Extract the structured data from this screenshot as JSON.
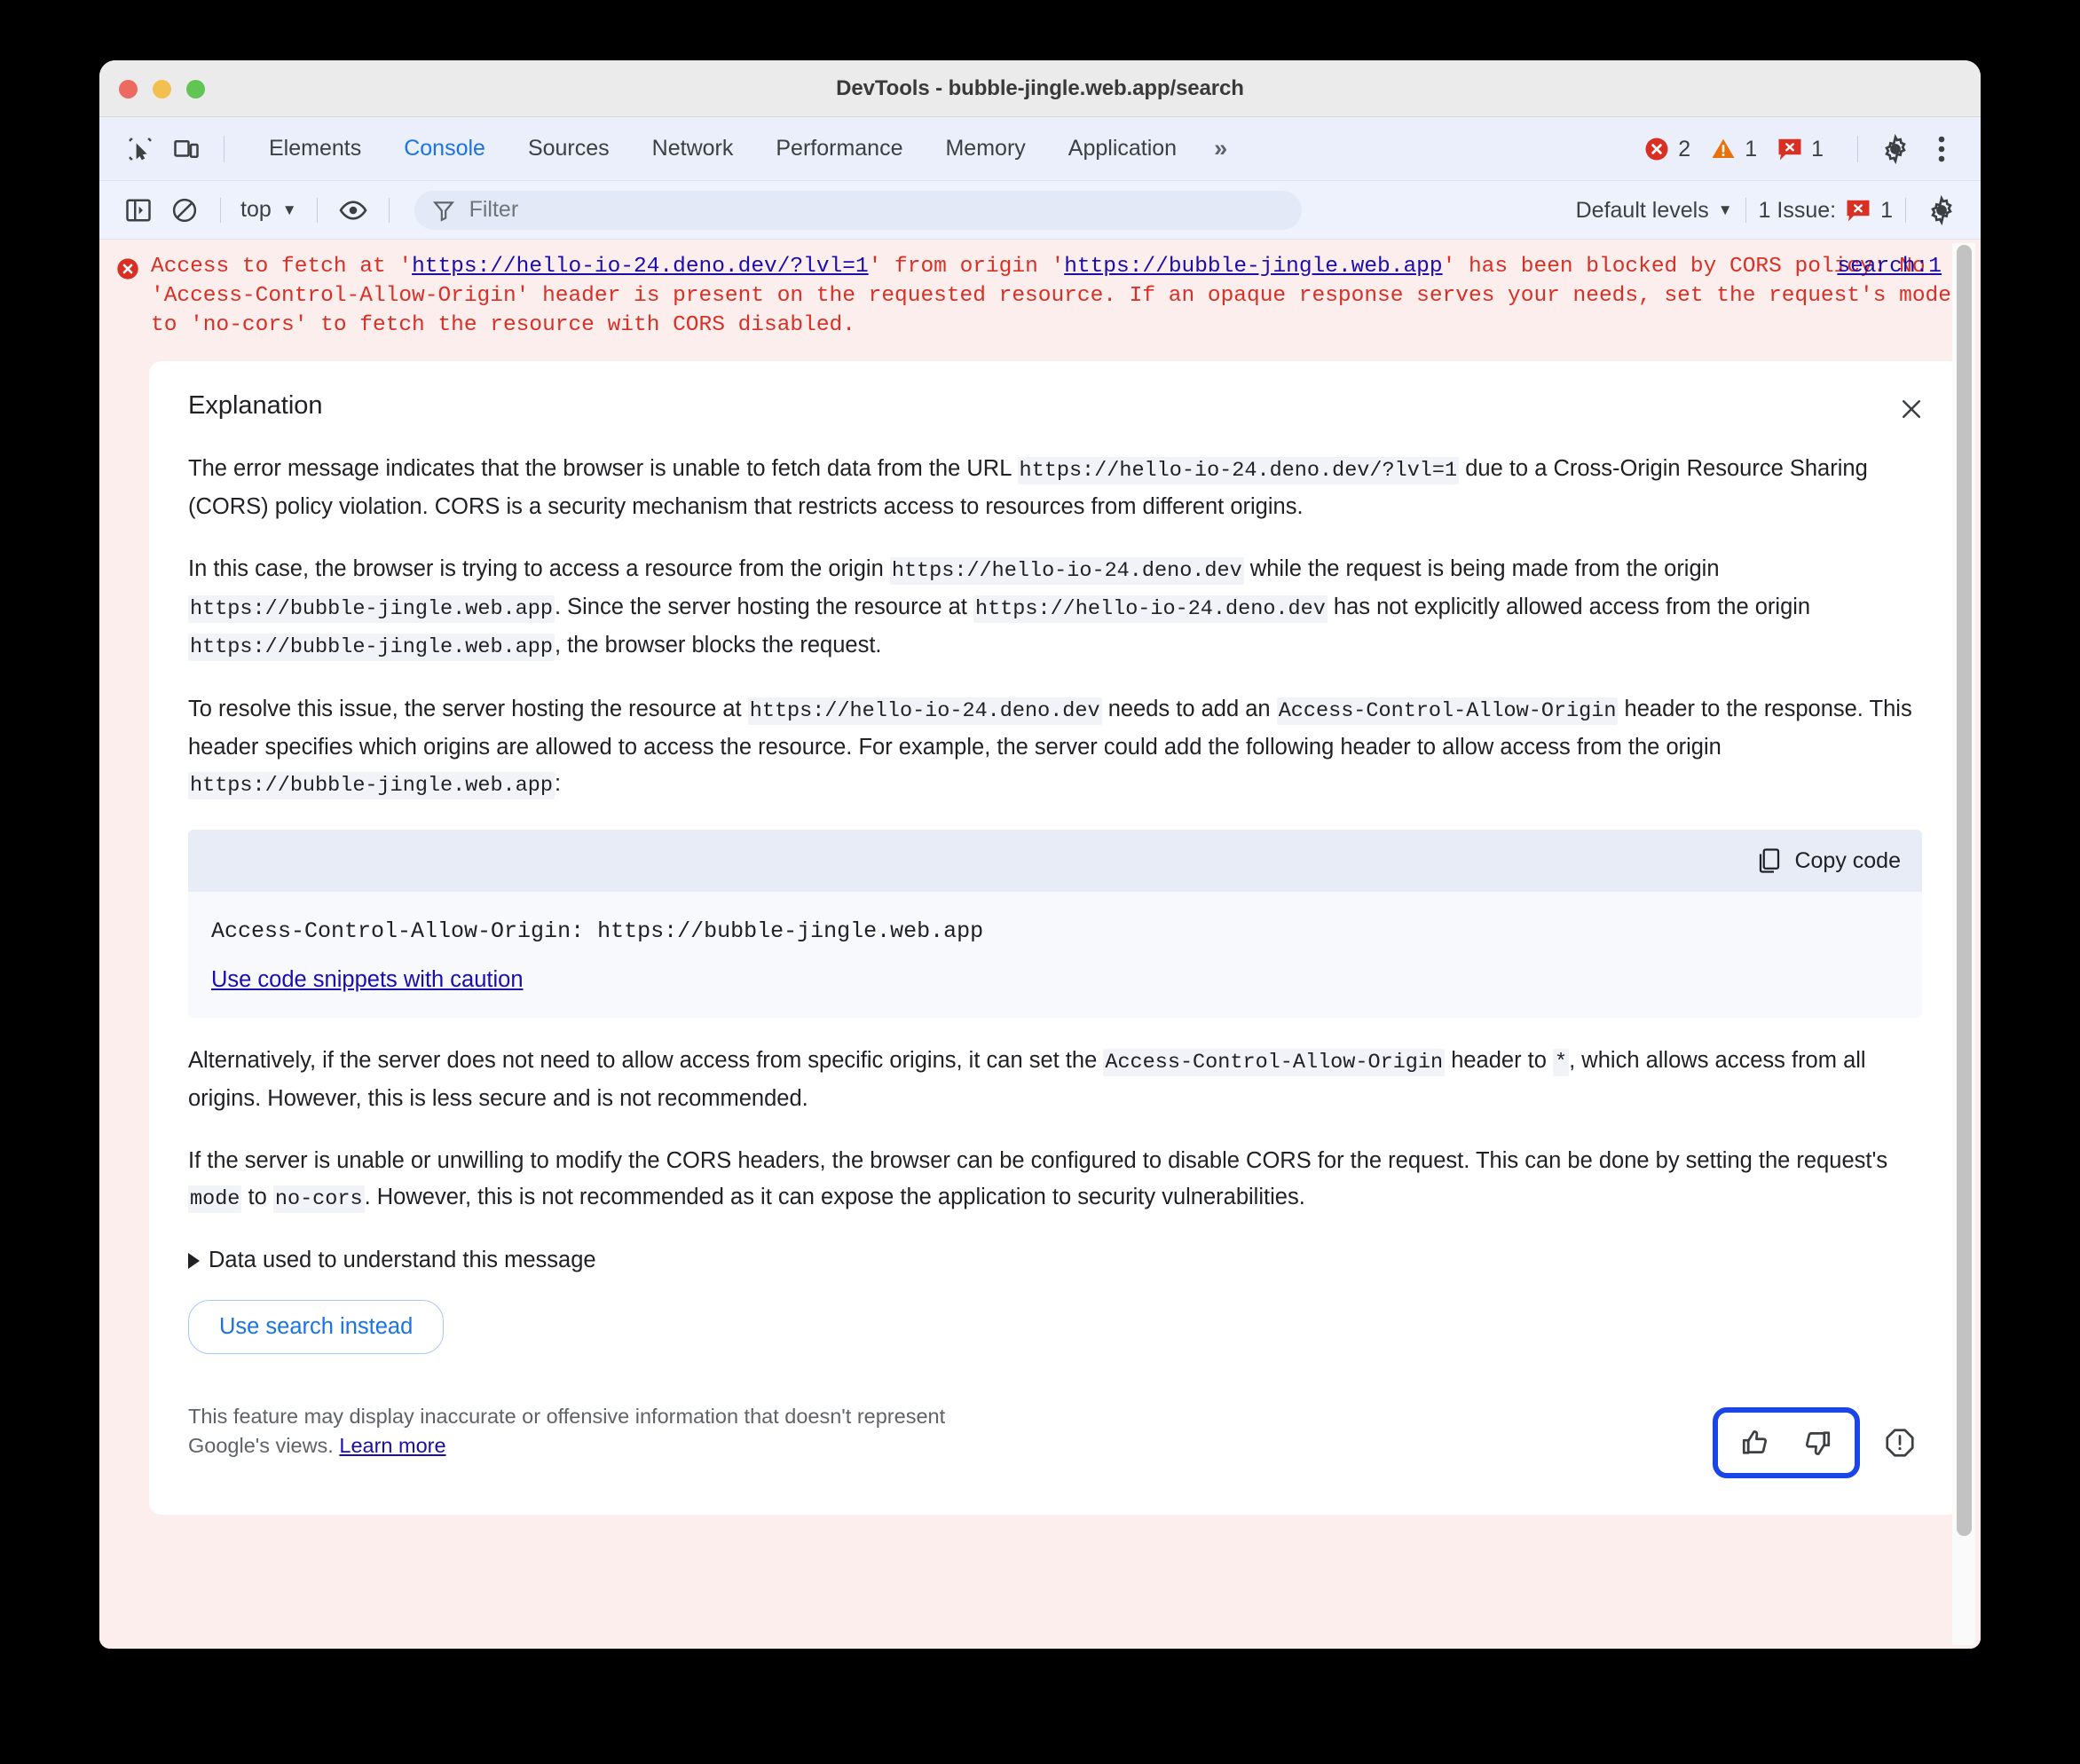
{
  "window": {
    "title": "DevTools - bubble-jingle.web.app/search",
    "traffic_lights": [
      "close",
      "minimize",
      "zoom"
    ]
  },
  "tabbar": {
    "inspect_icon": "inspect-element-icon",
    "device_icon": "device-toolbar-icon",
    "tabs": [
      {
        "label": "Elements",
        "active": false
      },
      {
        "label": "Console",
        "active": true
      },
      {
        "label": "Sources",
        "active": false
      },
      {
        "label": "Network",
        "active": false
      },
      {
        "label": "Performance",
        "active": false
      },
      {
        "label": "Memory",
        "active": false
      },
      {
        "label": "Application",
        "active": false
      }
    ],
    "overflow": "»",
    "counters": {
      "errors": "2",
      "warnings": "1",
      "issues": "1"
    },
    "settings_icon": "gear-icon",
    "more_icon": "three-dots-icon"
  },
  "filterbar": {
    "sidebar_icon": "show-console-sidebar-icon",
    "clear_icon": "clear-console-icon",
    "context": "top",
    "eye_icon": "live-expression-icon",
    "filter_icon": "filter-icon",
    "filter_value": "",
    "filter_placeholder": "Filter",
    "levels": "Default levels",
    "issues_label": "1 Issue:",
    "issues_count": "1",
    "settings_icon": "settings-gear-icon"
  },
  "console": {
    "error_icon": "error-circle-icon",
    "error_message_parts": [
      {
        "type": "text",
        "value": "Access to fetch at '"
      },
      {
        "type": "link",
        "value": "https://hello-io-24.deno.dev/?lvl=1"
      },
      {
        "type": "text",
        "value": "' from origin '"
      },
      {
        "type": "link",
        "value": "https://bubble-jingle.web.app"
      },
      {
        "type": "text",
        "value": "' has been blocked by CORS policy: No 'Access-Control-Allow-Origin' header is present on the requested resource. If an opaque response serves your needs, set the request's mode to 'no-cors' to fetch the resource with CORS disabled."
      }
    ],
    "source_link": "search:1"
  },
  "explanation": {
    "title": "Explanation",
    "close_icon": "close-icon",
    "paragraphs": [
      [
        {
          "t": "The error message indicates that the browser is unable to fetch data from the URL "
        },
        {
          "c": "https://hello-io-24.deno.dev/?lvl=1"
        },
        {
          "t": " due to a Cross-Origin Resource Sharing (CORS) policy violation. CORS is a security mechanism that restricts access to resources from different origins."
        }
      ],
      [
        {
          "t": "In this case, the browser is trying to access a resource from the origin "
        },
        {
          "c": "https://hello-io-24.deno.dev"
        },
        {
          "t": " while the request is being made from the origin "
        },
        {
          "c": "https://bubble-jingle.web.app"
        },
        {
          "t": ". Since the server hosting the resource at "
        },
        {
          "c": "https://hello-io-24.deno.dev"
        },
        {
          "t": " has not explicitly allowed access from the origin "
        },
        {
          "c": "https://bubble-jingle.web.app"
        },
        {
          "t": ", the browser blocks the request."
        }
      ],
      [
        {
          "t": "To resolve this issue, the server hosting the resource at "
        },
        {
          "c": "https://hello-io-24.deno.dev"
        },
        {
          "t": " needs to add an "
        },
        {
          "c": "Access-Control-Allow-Origin"
        },
        {
          "t": " header to the response. This header specifies which origins are allowed to access the resource. For example, the server could add the following header to allow access from the origin "
        },
        {
          "c": "https://bubble-jingle.web.app"
        },
        {
          "t": ":"
        }
      ]
    ],
    "code_block": {
      "copy_label": "Copy code",
      "copy_icon": "copy-icon",
      "code": "Access-Control-Allow-Origin: https://bubble-jingle.web.app",
      "caution_link": "Use code snippets with caution"
    },
    "paragraphs_after": [
      [
        {
          "t": "Alternatively, if the server does not need to allow access from specific origins, it can set the "
        },
        {
          "c": "Access-Control-Allow-Origin"
        },
        {
          "t": " header to "
        },
        {
          "c": "*"
        },
        {
          "t": ", which allows access from all origins. However, this is less secure and is not recommended."
        }
      ],
      [
        {
          "t": "If the server is unable or unwilling to modify the CORS headers, the browser can be configured to disable CORS for the request. This can be done by setting the request's "
        },
        {
          "c": "mode"
        },
        {
          "t": " to "
        },
        {
          "c": "no-cors"
        },
        {
          "t": ". However, this is not recommended as it can expose the application to security vulnerabilities."
        }
      ]
    ],
    "data_disclosure": "Data used to understand this message",
    "search_instead_button": "Use search instead",
    "disclaimer_text": "This feature may display inaccurate or offensive information that doesn't represent Google's views. ",
    "disclaimer_link": "Learn more",
    "thumbs_up_icon": "thumb-up-icon",
    "thumbs_down_icon": "thumb-down-icon",
    "report_icon": "report-icon"
  },
  "colors": {
    "accent_blue": "#1a73e8",
    "link_blue": "#1a0dab",
    "focus_ring": "#1a45e8",
    "error_red": "#d93025",
    "error_bg": "#fdeeee",
    "toolbar_bg": "#eef2fd",
    "tabbar_bg": "#eaeffb"
  }
}
